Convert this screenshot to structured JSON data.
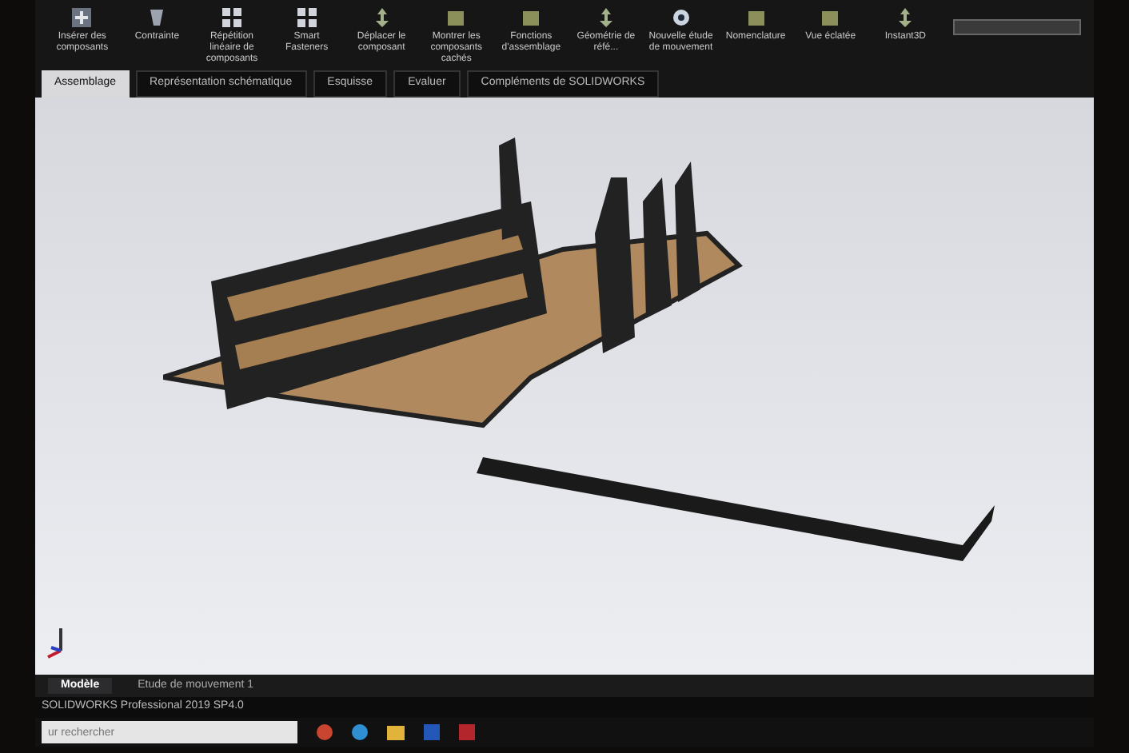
{
  "ribbon": {
    "buttons": [
      {
        "label": "Insérer des composants",
        "kind": "plus"
      },
      {
        "label": "Contrainte",
        "kind": "clip"
      },
      {
        "label": "Répétition linéaire de composants",
        "kind": "grid"
      },
      {
        "label": "Smart Fasteners",
        "kind": "grid"
      },
      {
        "label": "Déplacer le composant",
        "kind": "move"
      },
      {
        "label": "Montrer les composants cachés",
        "kind": "box"
      },
      {
        "label": "Fonctions d'assemblage",
        "kind": "box"
      },
      {
        "label": "Géométrie de réfé...",
        "kind": "move"
      },
      {
        "label": "Nouvelle étude de mouvement",
        "kind": "gear"
      },
      {
        "label": "Nomenclature",
        "kind": "box"
      },
      {
        "label": "Vue éclatée",
        "kind": "box"
      },
      {
        "label": "Instant3D",
        "kind": "move"
      }
    ]
  },
  "tabs": [
    {
      "label": "Assemblage",
      "selected": true
    },
    {
      "label": "Représentation schématique",
      "selected": false
    },
    {
      "label": "Esquisse",
      "selected": false
    },
    {
      "label": "Evaluer",
      "selected": false
    },
    {
      "label": "Compléments de SOLIDWORKS",
      "selected": false
    }
  ],
  "bottom_tabs": [
    {
      "label": "Modèle",
      "selected": true
    },
    {
      "label": "Etude de mouvement 1",
      "selected": false
    }
  ],
  "status_bar": {
    "text": "SOLIDWORKS Professional 2019 SP4.0"
  },
  "taskbar": {
    "search": {
      "placeholder": "ur rechercher"
    }
  }
}
